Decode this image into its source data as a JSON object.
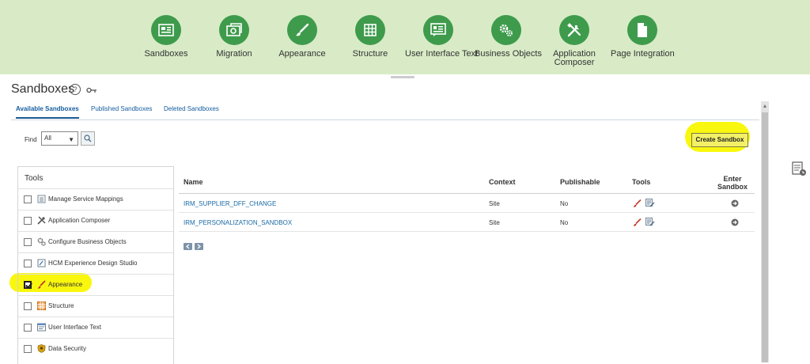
{
  "nav": [
    {
      "label": "Sandboxes",
      "icon": "sandboxes-icon"
    },
    {
      "label": "Migration",
      "icon": "migration-icon"
    },
    {
      "label": "Appearance",
      "icon": "appearance-icon"
    },
    {
      "label": "Structure",
      "icon": "structure-icon"
    },
    {
      "label": "User Interface Text",
      "icon": "ui-text-icon"
    },
    {
      "label": "Business Objects",
      "icon": "business-objects-icon"
    },
    {
      "label": "Application",
      "label2": "Composer",
      "icon": "app-composer-icon"
    },
    {
      "label": "Page Integration",
      "icon": "page-integration-icon"
    }
  ],
  "page": {
    "title": "Sandboxes",
    "help": "?"
  },
  "tabs": [
    "Available Sandboxes",
    "Published Sandboxes",
    "Deleted Sandboxes"
  ],
  "find": {
    "label": "Find",
    "value": "All"
  },
  "create_button": "Create Sandbox",
  "tools_panel": {
    "title": "Tools",
    "items": [
      {
        "label": "Manage Service Mappings",
        "checked": false
      },
      {
        "label": "Application Composer",
        "checked": false
      },
      {
        "label": "Configure Business Objects",
        "checked": false
      },
      {
        "label": "HCM Experience Design Studio",
        "checked": false
      },
      {
        "label": "Appearance",
        "checked": true
      },
      {
        "label": "Structure",
        "checked": false
      },
      {
        "label": "User Interface Text",
        "checked": false
      },
      {
        "label": "Data Security",
        "checked": false
      }
    ]
  },
  "table": {
    "headers": {
      "name": "Name",
      "context": "Context",
      "publishable": "Publishable",
      "tools": "Tools",
      "enter1": "Enter",
      "enter2": "Sandbox"
    },
    "rows": [
      {
        "name": "IRM_SUPPLIER_DFF_CHANGE",
        "context": "Site",
        "publishable": "No"
      },
      {
        "name": "IRM_PERSONALIZATION_SANDBOX",
        "context": "Site",
        "publishable": "No"
      }
    ]
  },
  "colors": {
    "nav_bg": "#d8ebc6",
    "nav_icon": "#3e9b4c",
    "highlight": "#f9f70d",
    "link": "#1a6aa6"
  }
}
